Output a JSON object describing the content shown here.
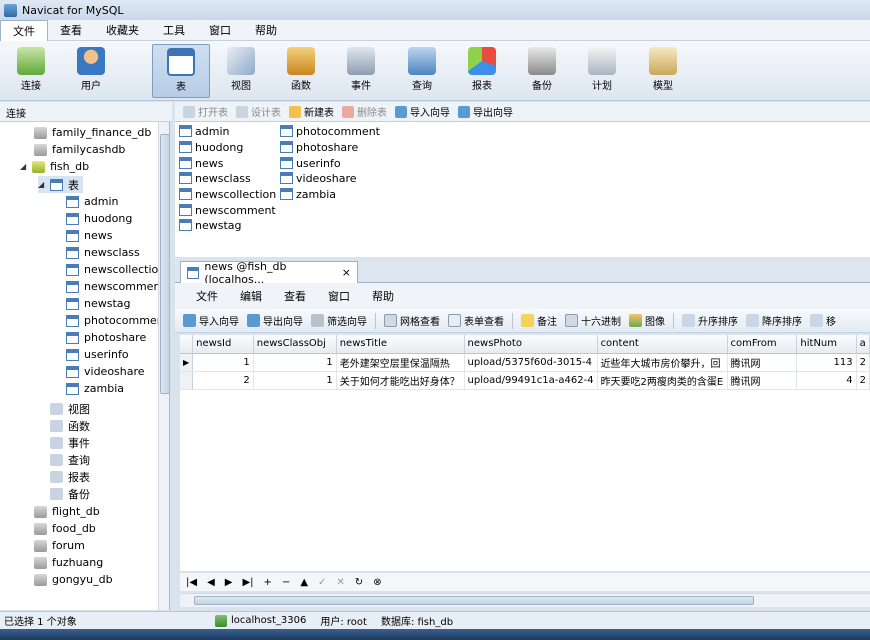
{
  "window": {
    "title": "Navicat for MySQL"
  },
  "menubar": [
    "文件",
    "查看",
    "收藏夹",
    "工具",
    "窗口",
    "帮助"
  ],
  "toolbar": [
    {
      "label": "连接",
      "icon": "connection-icon"
    },
    {
      "label": "用户",
      "icon": "user-icon"
    },
    {
      "label": "表",
      "icon": "table-icon"
    },
    {
      "label": "视图",
      "icon": "view-icon"
    },
    {
      "label": "函数",
      "icon": "function-icon"
    },
    {
      "label": "事件",
      "icon": "event-icon"
    },
    {
      "label": "查询",
      "icon": "query-icon"
    },
    {
      "label": "报表",
      "icon": "report-icon"
    },
    {
      "label": "备份",
      "icon": "backup-icon"
    },
    {
      "label": "计划",
      "icon": "schedule-icon"
    },
    {
      "label": "模型",
      "icon": "model-icon"
    }
  ],
  "connection_label": "连接",
  "object_toolbar": [
    "打开表",
    "设计表",
    "新建表",
    "删除表",
    "导入向导",
    "导出向导"
  ],
  "tree": {
    "dbs_before": [
      "family_finance_db",
      "familycashdb"
    ],
    "open_db": "fish_db",
    "tables_node": "表",
    "tables": [
      "admin",
      "huodong",
      "news",
      "newsclass",
      "newscollection",
      "newscomment",
      "newstag",
      "photocomment",
      "photoshare",
      "userinfo",
      "videoshare",
      "zambia"
    ],
    "other_nodes": [
      "视图",
      "函数",
      "事件",
      "查询",
      "报表",
      "备份"
    ],
    "dbs_after": [
      "flight_db",
      "food_db",
      "forum",
      "fuzhuang",
      "gongyu_db"
    ]
  },
  "object_list": {
    "col1": [
      "admin",
      "huodong",
      "news",
      "newsclass",
      "newscollection",
      "newscomment",
      "newstag"
    ],
    "col2": [
      "photocomment",
      "photoshare",
      "userinfo",
      "videoshare",
      "zambia"
    ]
  },
  "doc_tab": {
    "title": "news @fish_db (localhos...",
    "close": "×"
  },
  "inner_menu": [
    "文件",
    "编辑",
    "查看",
    "窗口",
    "帮助"
  ],
  "inner_toolbar": [
    "导入向导",
    "导出向导",
    "筛选向导",
    "网格查看",
    "表单查看",
    "备注",
    "十六进制",
    "图像",
    "升序排序",
    "降序排序",
    "移"
  ],
  "grid": {
    "columns": [
      "newsId",
      "newsClassObj",
      "newsTitle",
      "newsPhoto",
      "content",
      "comFrom",
      "hitNum",
      "a"
    ],
    "rows": [
      [
        "▶",
        "1",
        "1",
        "老外建架空层里保温隔热",
        "upload/5375f60d-3015-4",
        "近些年大城市房价攀升，回",
        "腾讯网",
        "113",
        "2"
      ],
      [
        "",
        "2",
        "1",
        "关于如何才能吃出好身体？",
        "upload/99491c1a-a462-4",
        "昨天要吃2两瘦肉类的含蛋E",
        "腾讯网",
        "4",
        "2"
      ]
    ]
  },
  "navbar": [
    "|◀",
    "◀",
    "▶",
    "▶|",
    "+",
    "−",
    "▲",
    "✓",
    "✕",
    "↻",
    "⊗"
  ],
  "status": {
    "selection": "已选择 1 个对象",
    "host": "localhost_3306",
    "user": "用户: root",
    "database": "数据库: fish_db"
  }
}
